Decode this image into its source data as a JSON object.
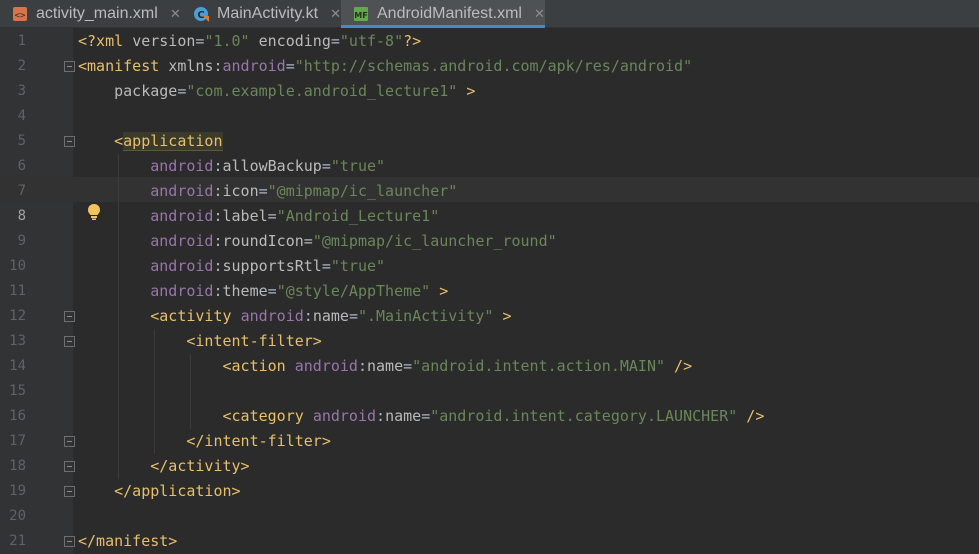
{
  "tabs": [
    {
      "label": "activity_main.xml",
      "icon": "layout-xml-icon",
      "icon_color": "#d9744a",
      "active": false
    },
    {
      "label": "MainActivity.kt",
      "icon": "kotlin-class-icon",
      "icon_color": "#4a9fd8",
      "active": false
    },
    {
      "label": "AndroidManifest.xml",
      "icon": "manifest-icon",
      "icon_color": "#62a84c",
      "active": true
    }
  ],
  "tab_close_glyph": "✕",
  "colors": {
    "tag": "#e8bf6a",
    "namespace": "#9876aa",
    "attribute": "#bababa",
    "string": "#6a8759",
    "text": "#a9b7c6",
    "accent": "#4a88c7",
    "bulb": "#f2c55c"
  },
  "current_line": 8,
  "lines": [
    {
      "n": "1",
      "segs": [
        [
          "pi",
          "<?xml "
        ],
        [
          "attr",
          "version"
        ],
        [
          "text",
          "="
        ],
        [
          "val",
          "\"1.0\""
        ],
        [
          "text",
          " "
        ],
        [
          "attr",
          "encoding"
        ],
        [
          "text",
          "="
        ],
        [
          "val",
          "\"utf-8\""
        ],
        [
          "pi",
          "?>"
        ]
      ]
    },
    {
      "n": "2",
      "segs": [
        [
          "tag",
          "<manifest "
        ],
        [
          "attr",
          "xmlns:"
        ],
        [
          "ns",
          "android"
        ],
        [
          "text",
          "="
        ],
        [
          "val",
          "\"http://schemas.android.com/apk/res/android\""
        ]
      ]
    },
    {
      "n": "3",
      "segs": [
        [
          "text",
          "    "
        ],
        [
          "attr",
          "package"
        ],
        [
          "text",
          "="
        ],
        [
          "val",
          "\"com.example.android_lecture1\""
        ],
        [
          "tag",
          " >"
        ]
      ]
    },
    {
      "n": "4",
      "segs": []
    },
    {
      "n": "5",
      "segs": [
        [
          "text",
          "    "
        ],
        [
          "tag",
          "<"
        ],
        [
          "taghl",
          "application"
        ]
      ]
    },
    {
      "n": "6",
      "segs": [
        [
          "text",
          "        "
        ],
        [
          "ns",
          "android"
        ],
        [
          "text",
          ":"
        ],
        [
          "attr",
          "allowBackup"
        ],
        [
          "text",
          "="
        ],
        [
          "val",
          "\"true\""
        ]
      ]
    },
    {
      "n": "7",
      "segs": [
        [
          "text",
          "        "
        ],
        [
          "ns",
          "android"
        ],
        [
          "text",
          ":"
        ],
        [
          "attr",
          "icon"
        ],
        [
          "text",
          "="
        ],
        [
          "val",
          "\"@mipmap/ic_launcher\""
        ]
      ]
    },
    {
      "n": "8",
      "segs": [
        [
          "text",
          "        "
        ],
        [
          "ns",
          "android"
        ],
        [
          "text",
          ":"
        ],
        [
          "attr",
          "label"
        ],
        [
          "text",
          "="
        ],
        [
          "val",
          "\"Android_Lecture1\""
        ]
      ]
    },
    {
      "n": "9",
      "segs": [
        [
          "text",
          "        "
        ],
        [
          "ns",
          "android"
        ],
        [
          "text",
          ":"
        ],
        [
          "attr",
          "roundIcon"
        ],
        [
          "text",
          "="
        ],
        [
          "val",
          "\"@mipmap/ic_launcher_round\""
        ]
      ]
    },
    {
      "n": "10",
      "segs": [
        [
          "text",
          "        "
        ],
        [
          "ns",
          "android"
        ],
        [
          "text",
          ":"
        ],
        [
          "attr",
          "supportsRtl"
        ],
        [
          "text",
          "="
        ],
        [
          "val",
          "\"true\""
        ]
      ]
    },
    {
      "n": "11",
      "segs": [
        [
          "text",
          "        "
        ],
        [
          "ns",
          "android"
        ],
        [
          "text",
          ":"
        ],
        [
          "attr",
          "theme"
        ],
        [
          "text",
          "="
        ],
        [
          "val",
          "\"@style/AppTheme\""
        ],
        [
          "tag",
          " >"
        ]
      ]
    },
    {
      "n": "12",
      "segs": [
        [
          "text",
          "        "
        ],
        [
          "tag",
          "<activity "
        ],
        [
          "ns",
          "android"
        ],
        [
          "text",
          ":"
        ],
        [
          "attr",
          "name"
        ],
        [
          "text",
          "="
        ],
        [
          "val",
          "\".MainActivity\""
        ],
        [
          "tag",
          " >"
        ]
      ]
    },
    {
      "n": "13",
      "segs": [
        [
          "text",
          "            "
        ],
        [
          "tag",
          "<intent-filter>"
        ]
      ]
    },
    {
      "n": "14",
      "segs": [
        [
          "text",
          "                "
        ],
        [
          "tag",
          "<action "
        ],
        [
          "ns",
          "android"
        ],
        [
          "text",
          ":"
        ],
        [
          "attr",
          "name"
        ],
        [
          "text",
          "="
        ],
        [
          "val",
          "\"android.intent.action.MAIN\""
        ],
        [
          "tag",
          " />"
        ]
      ]
    },
    {
      "n": "15",
      "segs": []
    },
    {
      "n": "16",
      "segs": [
        [
          "text",
          "                "
        ],
        [
          "tag",
          "<category "
        ],
        [
          "ns",
          "android"
        ],
        [
          "text",
          ":"
        ],
        [
          "attr",
          "name"
        ],
        [
          "text",
          "="
        ],
        [
          "val",
          "\"android.intent.category.LAUNCHER\""
        ],
        [
          "tag",
          " />"
        ]
      ]
    },
    {
      "n": "17",
      "segs": [
        [
          "text",
          "            "
        ],
        [
          "tag",
          "</intent-filter>"
        ]
      ]
    },
    {
      "n": "18",
      "segs": [
        [
          "text",
          "        "
        ],
        [
          "tag",
          "</activity>"
        ]
      ]
    },
    {
      "n": "19",
      "segs": [
        [
          "text",
          "    "
        ],
        [
          "tag",
          "</application>"
        ]
      ]
    },
    {
      "n": "20",
      "segs": []
    },
    {
      "n": "21",
      "segs": [
        [
          "tag",
          "</manifest>"
        ]
      ]
    }
  ],
  "fold_markers": [
    2,
    5,
    12,
    13,
    17,
    18,
    19,
    21
  ],
  "intention_bulb_line": 8
}
